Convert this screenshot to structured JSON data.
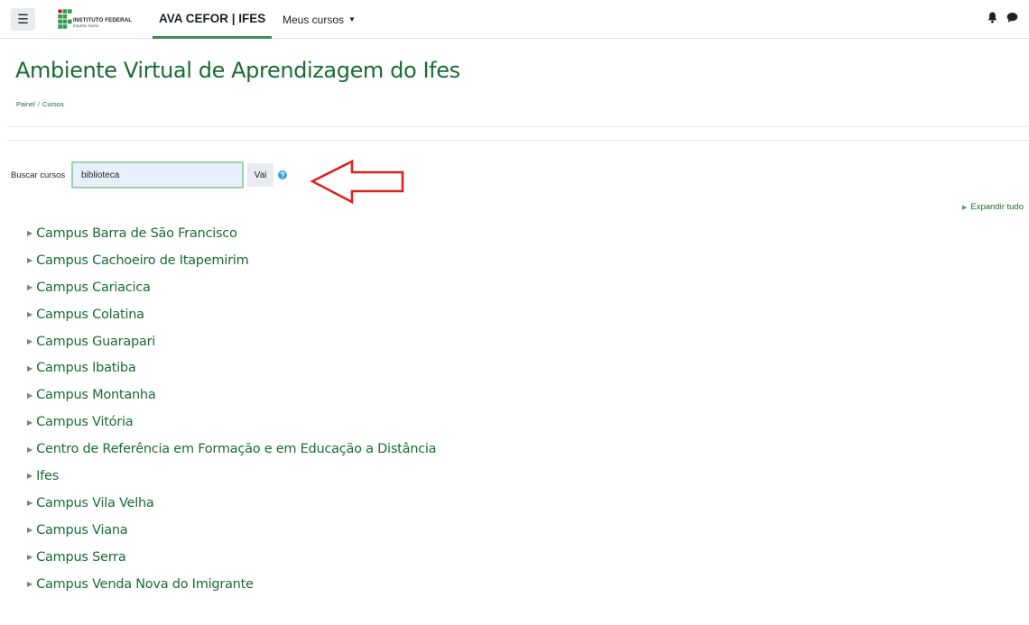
{
  "navbar": {
    "menu_icon": "hamburger-icon",
    "logo_line1": "INSTITUTO FEDERAL",
    "logo_line2": "Espírito Santo",
    "site_name": "AVA CEFOR | IFES",
    "my_courses": "Meus cursos",
    "notification_icon": "bell-icon",
    "messages_icon": "chat-icon"
  },
  "header": {
    "title": "Ambiente Virtual de Aprendizagem do Ifes",
    "breadcrumb": [
      "Painel",
      "Cursos"
    ]
  },
  "search": {
    "label": "Buscar cursos",
    "value": "biblioteca",
    "button": "Vai",
    "help_icon": "question-circle-icon",
    "annotation_icon": "red-arrow-left-icon"
  },
  "expand_all": "Expandir tudo",
  "categories": [
    "Campus Barra de São Francisco",
    "Campus Cachoeiro de Itapemirim",
    "Campus Cariacica",
    "Campus Colatina",
    "Campus Guarapari",
    "Campus Ibatiba",
    "Campus Montanha",
    "Campus Vitória",
    "Centro de Referência em Formação e em Educação a Distância",
    "Ifes",
    "Campus Vila Velha",
    "Campus Viana",
    "Campus Serra",
    "Campus Venda Nova do Imigrante"
  ],
  "colors": {
    "brand_green": "#1a6b32",
    "accent_underline": "#3d8b57",
    "annotation_red": "#e02020",
    "help_blue": "#3aa3d8"
  }
}
